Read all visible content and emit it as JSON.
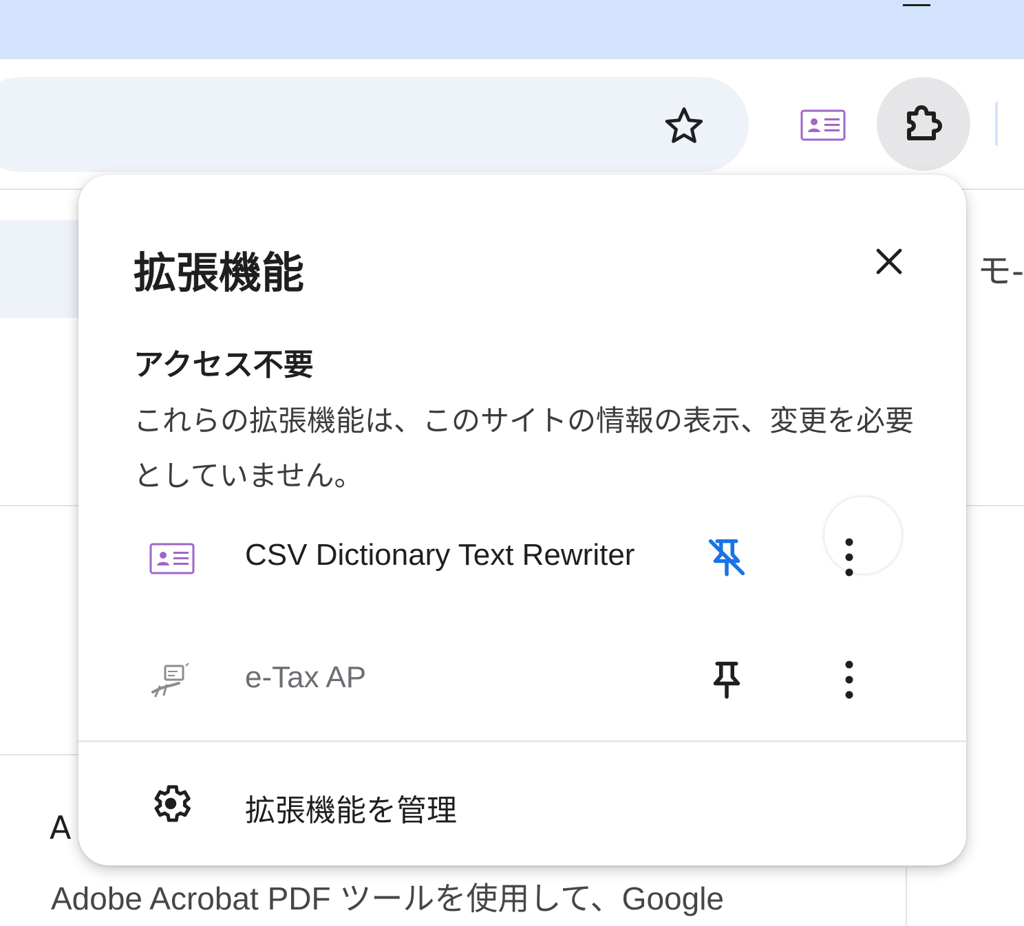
{
  "popup": {
    "title": "拡張機能",
    "section_title": "アクセス不要",
    "section_description": "これらの拡張機能は、このサイトの情報の表示、変更を必要としていません。",
    "extensions": [
      {
        "name": "CSV Dictionary Text Rewriter",
        "icon": "id-card-icon",
        "pinned": true
      },
      {
        "name": "e-Tax AP",
        "icon": "etax-icon",
        "pinned": false
      }
    ],
    "manage_label": "拡張機能を管理"
  },
  "page": {
    "right_fragment": "モ-",
    "title_fragment": "A",
    "description": "Adobe Acrobat PDF ツールを使用して、Google"
  },
  "colors": {
    "titlebar": "#d3e3fd",
    "omnibox": "#eef2f9",
    "pin_active": "#1a73e8",
    "id_card": "#a066c8"
  }
}
